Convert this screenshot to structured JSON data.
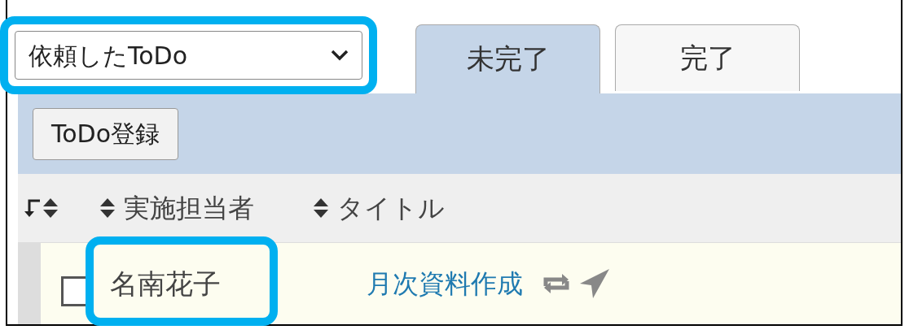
{
  "filter_select": {
    "value": "依頼したToDo",
    "highlighted": true
  },
  "tabs": [
    {
      "label": "未完了",
      "selected": true
    },
    {
      "label": "完了",
      "selected": false
    }
  ],
  "toolbar": {
    "button": "ToDo登録"
  },
  "table": {
    "columns": [
      {
        "label": "実施担当者"
      },
      {
        "label": "タイトル"
      }
    ],
    "rows": [
      {
        "checked": false,
        "assignee": "名南花子",
        "assignee_highlighted": true,
        "title": "月次資料作成",
        "recurring": true,
        "sent": true
      }
    ]
  }
}
